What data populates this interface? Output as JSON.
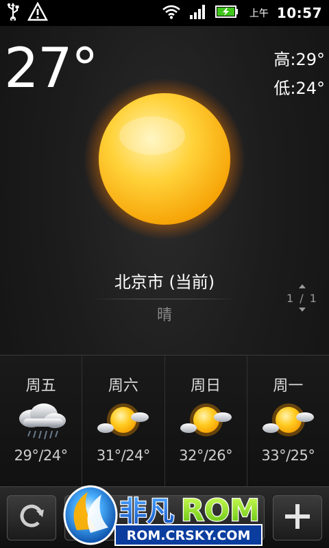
{
  "status_bar": {
    "left_icons": [
      "usb-icon",
      "warning-icon"
    ],
    "right_icons": [
      "wifi-icon",
      "signal-icon",
      "battery-charging-icon"
    ],
    "ampm": "上午",
    "time": "10:57"
  },
  "weather": {
    "current_temp": "27°",
    "high": "高:29°",
    "low": "低:24°",
    "icon": "sun-icon",
    "city": "北京市 (当前)",
    "condition": "晴",
    "pager": "1 / 1"
  },
  "forecast": [
    {
      "day": "周五",
      "icon": "rain-cloud-icon",
      "temps": "29°/24°"
    },
    {
      "day": "周六",
      "icon": "sun-cloud-icon",
      "temps": "31°/24°"
    },
    {
      "day": "周日",
      "icon": "sun-cloud-icon",
      "temps": "32°/26°"
    },
    {
      "day": "周一",
      "icon": "sun-cloud-icon",
      "temps": "33°/25°"
    }
  ],
  "toolbar": {
    "refresh_icon": "refresh-icon",
    "add_icon": "plus-icon",
    "middle_label": ""
  },
  "watermark": {
    "brand_left": "非凡",
    "brand_right": "ROM",
    "url": "ROM.CRSKY.COM"
  },
  "colors": {
    "background": "#1c1c1c",
    "sun_core": "#ffc21a",
    "watermark_blue": "#1d6fd6",
    "watermark_green": "#8ee01a"
  }
}
